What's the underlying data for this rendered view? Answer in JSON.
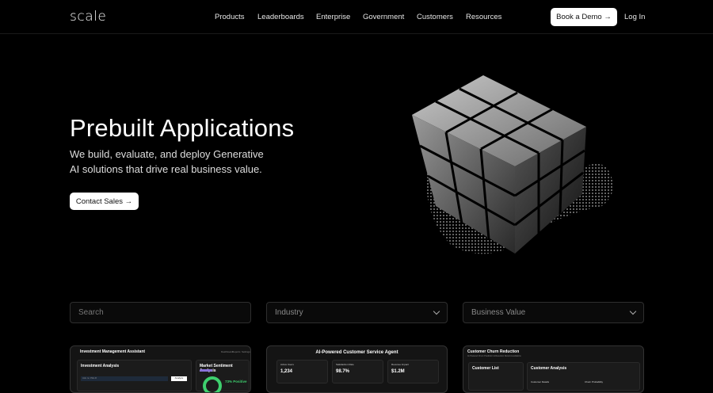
{
  "nav": {
    "logo": "scale",
    "items": [
      "Products",
      "Leaderboards",
      "Enterprise",
      "Government",
      "Customers",
      "Resources"
    ],
    "demo": "Book a Demo →",
    "login": "Log In"
  },
  "hero": {
    "title": "Prebuilt Applications",
    "line1": "We build, evaluate, and deploy Generative",
    "line2": "AI solutions that drive real business value.",
    "cta": "Contact Sales →"
  },
  "filters": {
    "search_placeholder": "Search",
    "industry": "Industry",
    "business_value": "Business Value"
  },
  "cards": [
    {
      "title": "Investment Management Assistant",
      "links": [
        "Dashboard",
        "Reports",
        "Settings"
      ],
      "panel1": "Investment Analysis",
      "input": "Ask re: PELR",
      "btn": "Analyze",
      "panel2": "Market Sentiment Analysis",
      "pos": "73% Positive"
    },
    {
      "title": "AI-Powered Customer Service Agent",
      "stats": [
        {
          "label": "Active Users",
          "value": "1,234"
        },
        {
          "label": "Satisfaction Rate",
          "value": "98.7%"
        },
        {
          "label": "Revenue Impact",
          "value": "$1.2M"
        }
      ]
    },
    {
      "title": "Customer Churn Reduction",
      "sub": "AI-Powered Churn Prediction & Retention Recommendations",
      "panel1": "Customer List",
      "panel2": "Customer Analysis",
      "details": "Customer Details",
      "prob": "Churn Probability"
    }
  ]
}
